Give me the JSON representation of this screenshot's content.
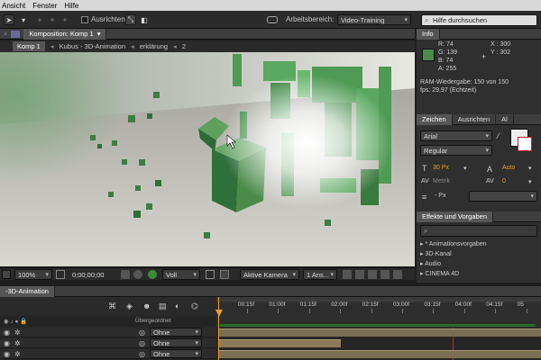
{
  "menu": [
    "Ansicht",
    "Fenster",
    "Hilfe"
  ],
  "toolbar": {
    "align_label": "Ausrichten",
    "workspace_label": "Arbeitsbereich:",
    "workspace_value": "Video-Training",
    "search_placeholder": "Hilfe durchsuchen"
  },
  "comp_panel": {
    "title": "Komposition: Komp 1",
    "breadcrumbs": [
      "Komp 1",
      "Kubus - 3D-Animation",
      "erklärung",
      "2"
    ]
  },
  "viewer_bar": {
    "zoom": "100%",
    "timecode": "0;00;00;00",
    "resolution": "Voll",
    "camera": "Aktive Kamera",
    "views": "1 Ans..."
  },
  "info": {
    "tab": "Info",
    "r": "R: 74",
    "g": "G: 139",
    "b": "B: 74",
    "a": "A: 255",
    "x": "X : 300",
    "y": "Y : 302",
    "ram": "RAM-Wiedergabe: 150 von 150",
    "fps": "fps: 29,97 (Echtzeit)",
    "swatch_color": "#4a8b4a"
  },
  "character": {
    "tabs": [
      "Zeichen",
      "Ausrichten",
      "Al"
    ],
    "font": "Arial",
    "style": "Regular",
    "size": "30 Px",
    "leading": "Auto",
    "kerning": "Metrik",
    "tracking": "0",
    "stroke": "- Px"
  },
  "effects": {
    "tab": "Effekte und Vorgaben",
    "items": [
      "* Animationsvorgaben",
      "3D-Kanal",
      "Audio",
      "CINEMA 4D"
    ]
  },
  "timeline": {
    "tab": "-3D-Animation",
    "column_parent": "Übergeordnet",
    "ticks": [
      "00:15f",
      "01:00f",
      "01:15f",
      "02:00f",
      "02:15f",
      "03:00f",
      "03:15f",
      "04:00f",
      "04:15f",
      "05"
    ],
    "rows": [
      {
        "parent": "Ohne"
      },
      {
        "parent": "Ohne"
      },
      {
        "parent": "Ohne"
      }
    ]
  }
}
